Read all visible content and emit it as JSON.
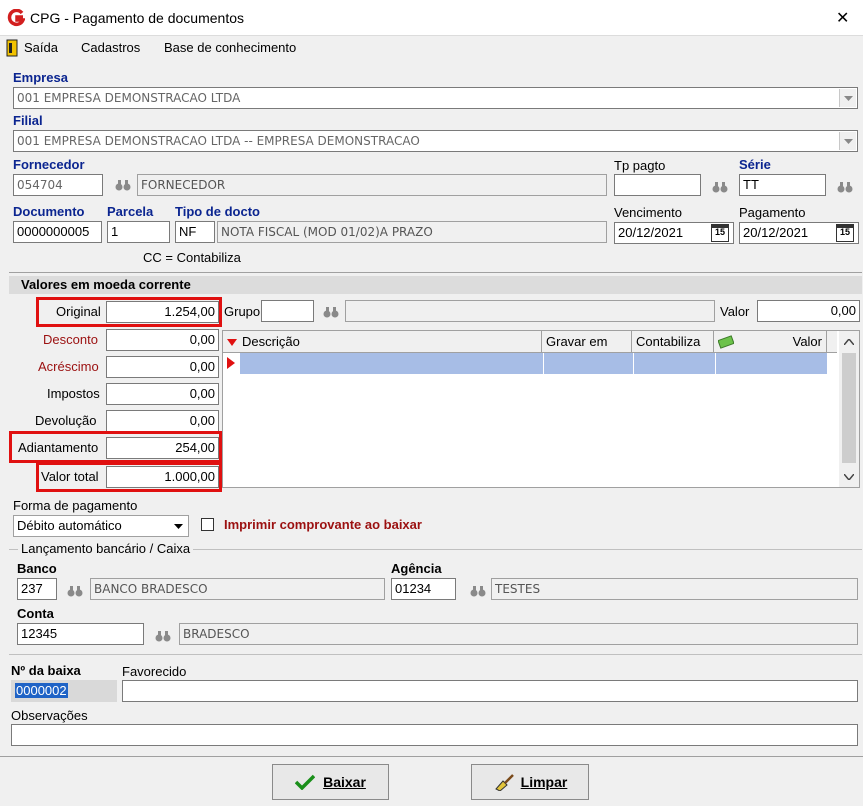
{
  "window": {
    "title": "CPG - Pagamento de documentos",
    "close_glyph": "✕"
  },
  "menu": {
    "items": [
      "Saída",
      "Cadastros",
      "Base de conhecimento"
    ]
  },
  "empresa": {
    "label": "Empresa",
    "value": "001 EMPRESA DEMONSTRACAO LTDA"
  },
  "filial": {
    "label": "Filial",
    "value": "001 EMPRESA DEMONSTRACAO LTDA -- EMPRESA DEMONSTRACAO"
  },
  "fornecedor": {
    "label": "Fornecedor",
    "code": "054704",
    "name": "FORNECEDOR"
  },
  "tp_pagto": {
    "label": "Tp pagto",
    "value": ""
  },
  "serie": {
    "label": "Série",
    "value": "TT"
  },
  "documento": {
    "label": "Documento",
    "value": "0000000005"
  },
  "parcela": {
    "label": "Parcela",
    "value": "1"
  },
  "tipo_docto": {
    "label": "Tipo de docto",
    "code": "NF",
    "description": "NOTA FISCAL (MOD 01/02)A PRAZO"
  },
  "cc_note": "CC = Contabiliza",
  "vencimento": {
    "label": "Vencimento",
    "value": "20/12/2021"
  },
  "pagamento": {
    "label": "Pagamento",
    "value": "20/12/2021"
  },
  "calendar_glyph": "15",
  "valores": {
    "title": "Valores em moeda corrente",
    "original": {
      "label": "Original",
      "value": "1.254,00"
    },
    "desconto": {
      "label": "Desconto",
      "value": "0,00"
    },
    "acrescimo": {
      "label": "Acréscimo",
      "value": "0,00"
    },
    "impostos": {
      "label": "Impostos",
      "value": "0,00"
    },
    "devolucao": {
      "label": "Devolução",
      "value": "0,00"
    },
    "adiantamento": {
      "label": "Adiantamento",
      "value": "254,00"
    },
    "valor_total": {
      "label": "Valor total",
      "value": "1.000,00"
    }
  },
  "grupo": {
    "label": "Grupo",
    "code": "",
    "name": ""
  },
  "valor": {
    "label": "Valor",
    "value": "0,00"
  },
  "grid": {
    "columns": [
      "Descrição",
      "Gravar em",
      "Contabiliza",
      "Valor"
    ]
  },
  "forma_pagamento": {
    "label": "Forma de pagamento",
    "value": "Débito automático"
  },
  "imprimir": {
    "label": "Imprimir comprovante ao baixar",
    "checked": false
  },
  "lancamento": {
    "title": "Lançamento bancário / Caixa"
  },
  "banco": {
    "label": "Banco",
    "code": "237",
    "name": "BANCO BRADESCO"
  },
  "agencia": {
    "label": "Agência",
    "code": "01234",
    "name": "TESTES"
  },
  "conta": {
    "label": "Conta",
    "code": "12345",
    "name": "BRADESCO"
  },
  "nro_baixa": {
    "label": "Nº da baixa",
    "value": "0000002"
  },
  "favorecido": {
    "label": "Favorecido",
    "value": ""
  },
  "observacoes": {
    "label": "Observações",
    "value": ""
  },
  "buttons": {
    "baixar": "Baixar",
    "limpar": "Limpar"
  },
  "colors": {
    "label_blue": "#0b2590",
    "label_red": "#9b1010",
    "highlight": "#e01010",
    "selection": "#a7bde6"
  }
}
